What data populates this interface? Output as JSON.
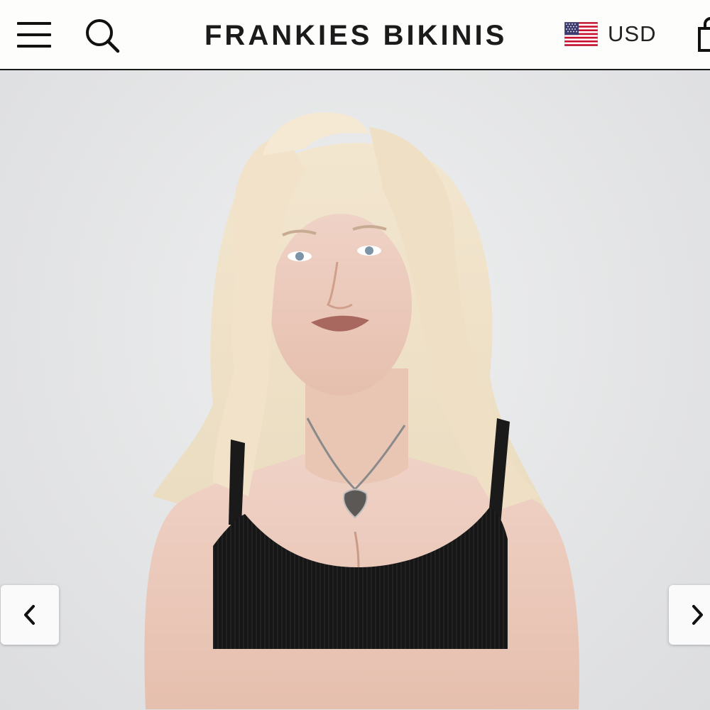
{
  "header": {
    "brand": "FRANKIES BIKINIS",
    "menu_icon": "hamburger-menu-icon",
    "search_icon": "search-icon",
    "currency": {
      "flag_icon": "us-flag-icon",
      "label": "USD"
    },
    "cart_icon": "shopping-bag-icon"
  },
  "gallery": {
    "image_alt": "Model wearing black ribbed bikini top",
    "prev_icon": "chevron-left-icon",
    "next_icon": "chevron-right-icon"
  },
  "colors": {
    "header_bg": "#fdfdfb",
    "text": "#1b1b1b",
    "hero_bg": "#e6e7e8"
  }
}
